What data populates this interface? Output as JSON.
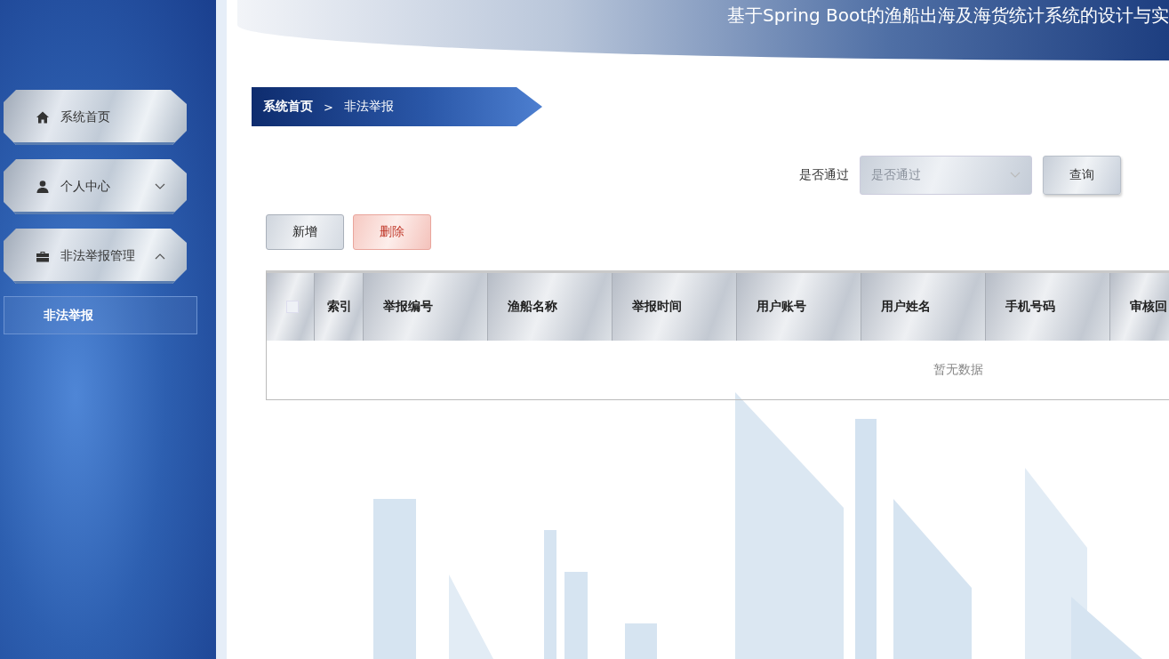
{
  "header": {
    "title": "基于Spring Boot的渔船出海及海货统计系统的设计与实"
  },
  "sidebar": {
    "items": [
      {
        "label": "系统首页"
      },
      {
        "label": "个人中心",
        "expanded": false
      },
      {
        "label": "非法举报管理",
        "expanded": true,
        "children": [
          {
            "label": "非法举报",
            "selected": true
          }
        ]
      }
    ]
  },
  "breadcrumb": {
    "items": [
      "系统首页",
      "非法举报"
    ],
    "separator": ">"
  },
  "filter": {
    "label": "是否通过",
    "select": {
      "placeholder": "是否通过"
    },
    "button": "查询"
  },
  "actions": [
    {
      "label": "新增",
      "kind": "add"
    },
    {
      "label": "删除",
      "kind": "delete"
    }
  ],
  "table": {
    "select_all": {
      "checked": false
    },
    "columns": [
      "索引",
      "举报编号",
      "渔船名称",
      "举报时间",
      "用户账号",
      "用户姓名",
      "手机号码",
      "审核回"
    ],
    "empty_text": "暂无数据"
  }
}
